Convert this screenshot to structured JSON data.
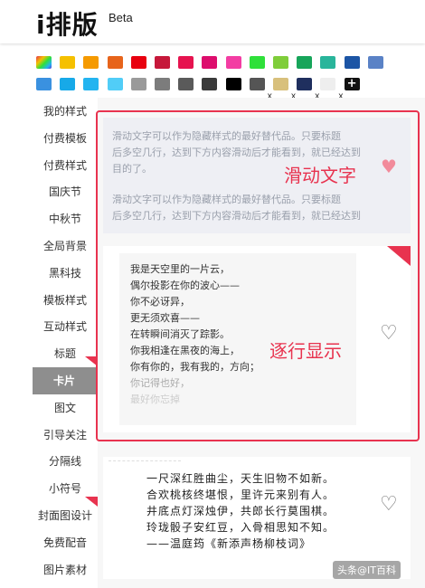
{
  "header": {
    "logo": "i排版",
    "beta": "Beta"
  },
  "palette": {
    "row1": [
      "#5d8fd6",
      "#f5c000",
      "#f59a00",
      "#e7641b",
      "#e8000f",
      "#c6183a",
      "#e6134f",
      "#dd0d6d",
      "#f33da3",
      "#2fe03a",
      "#7fcd3a",
      "#17a55a",
      "#29b59b",
      "#1c55a5",
      "#5a82c6"
    ],
    "row2": [
      "#3a91e0",
      "#17a9e8",
      "#23b4f0",
      "#51cdf7",
      "#9a9a9a",
      "#7c7c7c",
      "#5a5a5a",
      "#3a3a3a",
      "#000000",
      "#555555",
      "#d8c07c",
      "#1f2f5e",
      "#eeeeee"
    ],
    "plus": "+",
    "x_mark": "x"
  },
  "sidebar": {
    "items": [
      {
        "label": "我的样式"
      },
      {
        "label": "付费模板"
      },
      {
        "label": "付费样式"
      },
      {
        "label": "国庆节"
      },
      {
        "label": "中秋节"
      },
      {
        "label": "全局背景"
      },
      {
        "label": "黑科技"
      },
      {
        "label": "模板样式"
      },
      {
        "label": "互动样式"
      },
      {
        "label": "标题"
      },
      {
        "label": "卡片"
      },
      {
        "label": "图文"
      },
      {
        "label": "引导关注"
      },
      {
        "label": "分隔线"
      },
      {
        "label": "小符号"
      },
      {
        "label": "封面图设计"
      },
      {
        "label": "免费配音"
      },
      {
        "label": "图片素材"
      }
    ],
    "active": "卡片"
  },
  "card1": {
    "para1_line1": "滑动文字可以作为隐藏样式的最好替代品。只要标题",
    "para1_line2": "后多空几行，达到下方内容滑动后才能看到，就已经达到",
    "para1_line3": "目的了。",
    "para2_line1": "滑动文字可以作为隐藏样式的最好替代品。只要标题",
    "para2_line2": "后多空几行，达到下方内容滑动后才能看到，就已经达到",
    "annotation": "滑动文字"
  },
  "card2": {
    "lines": [
      "我是天空里的一片云，",
      "偶尔投影在你的波心——",
      "你不必讶异，",
      "更无须欢喜——",
      "在转瞬间消灭了踪影。",
      "你我相逢在黑夜的海上，",
      "你有你的，我有我的，方向；",
      "你记得也好，",
      "最好你忘掉"
    ],
    "annotation": "逐行显示"
  },
  "card3": {
    "lines": [
      "一尺深红胜曲尘，天生旧物不如新。",
      "合欢桃核终堪恨，里许元来别有人。",
      "井底点灯深烛伊，共郎长行莫围棋。",
      "玲珑骰子安红豆，入骨相思知不知。",
      "——温庭筠《新添声杨柳枝词》"
    ]
  },
  "watermark": "头条@IT百科"
}
